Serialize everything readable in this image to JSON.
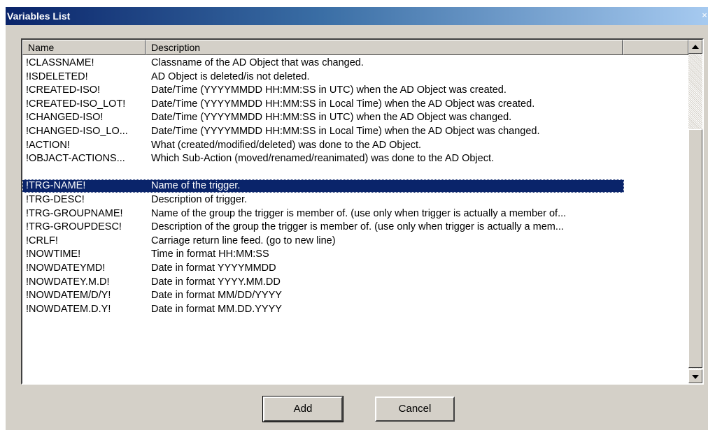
{
  "window": {
    "title": "Variables List",
    "close_glyph": "×"
  },
  "list": {
    "columns": [
      "Name",
      "Description"
    ],
    "rows": [
      {
        "name": "!CLASSNAME!",
        "desc": "Classname of the AD Object that was changed."
      },
      {
        "name": "!ISDELETED!",
        "desc": "AD Object is deleted/is not deleted."
      },
      {
        "name": "!CREATED-ISO!",
        "desc": "Date/Time (YYYYMMDD HH:MM:SS in UTC) when the AD Object was created."
      },
      {
        "name": "!CREATED-ISO_LOT!",
        "desc": "Date/Time (YYYYMMDD HH:MM:SS in Local Time) when the AD Object was created."
      },
      {
        "name": "!CHANGED-ISO!",
        "desc": "Date/Time (YYYYMMDD HH:MM:SS in UTC) when the AD Object was changed."
      },
      {
        "name": "!CHANGED-ISO_LO...",
        "desc": "Date/Time (YYYYMMDD HH:MM:SS in Local Time) when the AD Object was changed."
      },
      {
        "name": "!ACTION!",
        "desc": "What (created/modified/deleted) was done to the AD Object."
      },
      {
        "name": "!OBJACT-ACTIONS...",
        "desc": "Which Sub-Action (moved/renamed/reanimated) was done to the AD Object."
      },
      {
        "name": "",
        "desc": ""
      },
      {
        "name": "!TRG-NAME!",
        "desc": "Name of the trigger.",
        "selected": true
      },
      {
        "name": "!TRG-DESC!",
        "desc": "Description of trigger."
      },
      {
        "name": "!TRG-GROUPNAME!",
        "desc": "Name of the group the trigger is member of. (use only when trigger is actually a member of..."
      },
      {
        "name": "!TRG-GROUPDESC!",
        "desc": "Description of the group the trigger is member of. (use only when trigger is actually a mem..."
      },
      {
        "name": "!CRLF!",
        "desc": "Carriage return line feed. (go to new line)"
      },
      {
        "name": "!NOWTIME!",
        "desc": "Time in format HH:MM:SS"
      },
      {
        "name": "!NOWDATEYMD!",
        "desc": "Date in format YYYYMMDD"
      },
      {
        "name": "!NOWDATEY.M.D!",
        "desc": "Date in format YYYY.MM.DD"
      },
      {
        "name": "!NOWDATEM/D/Y!",
        "desc": "Date in format MM/DD/YYYY"
      },
      {
        "name": "!NOWDATEM.D.Y!",
        "desc": "Date in format MM.DD.YYYY"
      }
    ]
  },
  "buttons": {
    "add": "Add",
    "cancel": "Cancel"
  },
  "colors": {
    "selection": "#0a246a",
    "face": "#d4d0c8",
    "title_start": "#0a246a",
    "title_end": "#a6caf0"
  }
}
